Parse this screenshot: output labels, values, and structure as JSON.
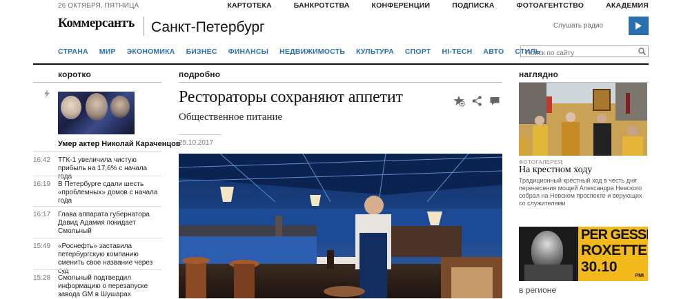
{
  "header": {
    "date": "26 ОКТЯБРЯ, ПЯТНИЦА",
    "top_links": [
      "КАРТОТЕКА",
      "БАНКРОТСТВА",
      "КОНФЕРЕНЦИИ",
      "ПОДПИСКА",
      "ФОТОАГЕНТСТВО",
      "АКАДЕМИЯ"
    ],
    "logo": "Коммерсантъ",
    "city": "Санкт-Петербург",
    "radio_label": "Слушать радио",
    "brand_color": "#2a6fb0"
  },
  "nav": {
    "items": [
      "СТРАНА",
      "МИР",
      "ЭКОНОМИКА",
      "БИЗНЕС",
      "ФИНАНСЫ",
      "НЕДВИЖИМОСТЬ",
      "КУЛЬТУРА",
      "СПОРТ",
      "HI-TECH",
      "АВТО",
      "СТИЛЬ"
    ],
    "search_placeholder": "Поиск по сайту"
  },
  "left": {
    "heading": "коротко",
    "featured_headline": "Умер актер Николай Караченцов",
    "news": [
      {
        "time": "16:42",
        "headline": "ТГК-1 увеличила чистую прибыль на 17,6% с начала года"
      },
      {
        "time": "16:19",
        "headline": "В Петербурге сдали шесть «проблемных» домов с начала года"
      },
      {
        "time": "16:17",
        "headline": "Глава аппарата губернатора Давид Адамия покидает Смольный"
      },
      {
        "time": "15:49",
        "headline": "«Роснефть» заставила петербургскую компанию сменить свое название через суд"
      },
      {
        "time": "15:28",
        "headline": "Смольный подтвердил информацию о перезапуске завода GM в Шушарах"
      }
    ]
  },
  "center": {
    "heading": "подробно",
    "title": "Рестораторы сохраняют аппетит",
    "subtitle": "Общественное питание",
    "date": "25.10.2017"
  },
  "right": {
    "heading": "наглядно",
    "gallery_label": "ФОТОГАЛЕРЕЯ:",
    "gallery_title": "На крестном ходу",
    "gallery_desc": "Традиционный крестный ход в честь дня перенесения мощей Александра Невского собрал на Невском проспекте и верующих со служителями",
    "ad": {
      "line1": "PER GESSLE'S",
      "line2": "ROXETTE",
      "date": "30.10",
      "small": "PMI"
    },
    "region_label": "в регионе"
  }
}
